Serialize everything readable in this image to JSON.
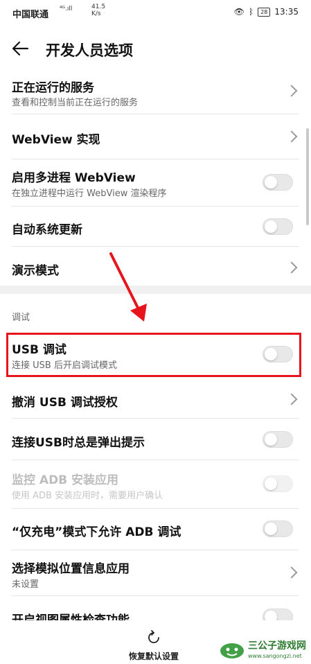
{
  "status_bar": {
    "carrier": "中国联通",
    "network": "⁴ᴳ.ıll",
    "speed_value": "41.5",
    "speed_unit": "K/s",
    "battery": "28",
    "time": "13:35"
  },
  "header": {
    "title": "开发人员选项"
  },
  "rows": [
    {
      "title": "正在运行的服务",
      "subtitle": "查看和控制当前正在运行的服务",
      "control": "chevron"
    },
    {
      "title": "WebView 实现",
      "control": "chevron"
    },
    {
      "title": "启用多进程 WebView",
      "subtitle": "在独立进程中运行 WebView 渲染程序",
      "control": "toggle",
      "on": false
    },
    {
      "title": "自动系统更新",
      "control": "toggle",
      "on": false
    },
    {
      "title": "演示模式",
      "control": "chevron"
    },
    {
      "title": "USB 调试",
      "subtitle": "连接 USB 后开启调试模式",
      "control": "toggle",
      "on": false
    },
    {
      "title": "撤消 USB 调试授权",
      "control": "chevron"
    },
    {
      "title": "连接USB时总是弹出提示",
      "control": "toggle",
      "on": false
    },
    {
      "title": "监控 ADB 安装应用",
      "subtitle": "使用 ADB 安装应用时，需要用户确认",
      "control": "toggle",
      "on": false,
      "disabled": true
    },
    {
      "title": "“仅充电”模式下允许 ADB 调试",
      "control": "toggle",
      "on": false
    },
    {
      "title": "选择模拟位置信息应用",
      "subtitle": "未设置",
      "control": "chevron"
    },
    {
      "title": "开启视图属性检查功能",
      "control": "toggle",
      "on": false
    }
  ],
  "section_debug": "调试",
  "bottom": {
    "reset_label": "恢复默认设置"
  },
  "watermark": {
    "name": "三公子游戏网",
    "url": "www.sangongzi.net"
  },
  "colors": {
    "highlight": "#e8141c",
    "arrow": "#e8141c"
  }
}
